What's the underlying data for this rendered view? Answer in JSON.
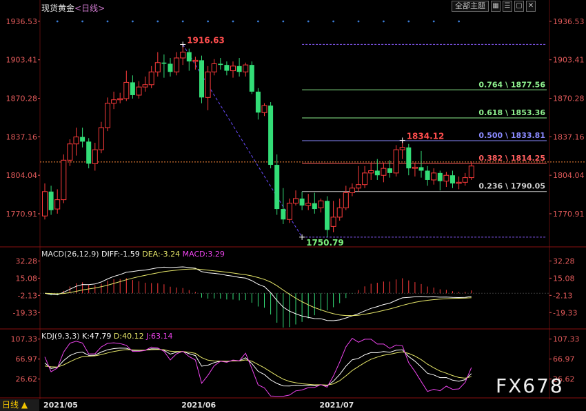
{
  "header": {
    "symbol": "现货黄金",
    "period": "<日线>",
    "main_indicator_button": "全部主题",
    "icons": [
      "grid-icon",
      "list-icon",
      "window-icon",
      "close-icon"
    ]
  },
  "footer": {
    "period_tab": "日线 ▲",
    "watermark": "FX678"
  },
  "chart_data": [
    {
      "type": "candlestick",
      "panel": "price",
      "y_ticks": [
        "1936.53",
        "1903.41",
        "1870.28",
        "1837.16",
        "1804.04",
        "1770.91"
      ],
      "y_tick_values": [
        1936.53,
        1903.41,
        1870.28,
        1837.16,
        1804.04,
        1770.91
      ],
      "ylim": [
        1743,
        1943
      ],
      "x_labels": [
        {
          "label": "2021/05",
          "index": 0
        },
        {
          "label": "2021/06",
          "index": 22
        },
        {
          "label": "2021/07",
          "index": 44
        }
      ],
      "annotations": [
        {
          "text": "1916.63",
          "index": 22,
          "value": 1916.63,
          "color": "#ff4d4d"
        },
        {
          "text": "1750.79",
          "index": 41,
          "value": 1750.79,
          "color": "#7cf07c"
        },
        {
          "text": "1834.12",
          "index": 57,
          "value": 1834.12,
          "color": "#ff4d4d"
        }
      ],
      "current_price_line": 1815.5,
      "fibonacci": {
        "from_index": 41,
        "levels": [
          {
            "label": "0.764 \\ 1877.56",
            "value": 1877.56,
            "color": "#8ef08e"
          },
          {
            "label": "0.618 \\ 1853.36",
            "value": 1853.36,
            "color": "#8ef08e"
          },
          {
            "label": "0.500 \\ 1833.81",
            "value": 1833.81,
            "color": "#8a8aff"
          },
          {
            "label": "0.382 \\ 1814.25",
            "value": 1814.25,
            "color": "#ff5e5e"
          },
          {
            "label": "0.236 \\ 1790.05",
            "value": 1790.05,
            "color": "#d0d0d0"
          }
        ],
        "top_value": 1916.63,
        "bottom_value": 1750.79
      },
      "candles": [
        {
          "o": 1769,
          "h": 1797,
          "c": 1790,
          "l": 1766
        },
        {
          "o": 1790,
          "h": 1795,
          "c": 1774,
          "l": 1770
        },
        {
          "o": 1775,
          "h": 1792,
          "c": 1783,
          "l": 1771
        },
        {
          "o": 1783,
          "h": 1822,
          "c": 1817,
          "l": 1780
        },
        {
          "o": 1817,
          "h": 1835,
          "c": 1831,
          "l": 1812
        },
        {
          "o": 1831,
          "h": 1845,
          "c": 1837,
          "l": 1821
        },
        {
          "o": 1837,
          "h": 1845,
          "c": 1833,
          "l": 1828
        },
        {
          "o": 1833,
          "h": 1836,
          "c": 1814,
          "l": 1810
        },
        {
          "o": 1814,
          "h": 1832,
          "c": 1826,
          "l": 1808
        },
        {
          "o": 1826,
          "h": 1850,
          "c": 1845,
          "l": 1823
        },
        {
          "o": 1845,
          "h": 1871,
          "c": 1866,
          "l": 1842
        },
        {
          "o": 1866,
          "h": 1876,
          "c": 1869,
          "l": 1861
        },
        {
          "o": 1869,
          "h": 1875,
          "c": 1870,
          "l": 1866
        },
        {
          "o": 1870,
          "h": 1894,
          "c": 1884,
          "l": 1868
        },
        {
          "o": 1884,
          "h": 1890,
          "c": 1873,
          "l": 1870
        },
        {
          "o": 1873,
          "h": 1885,
          "c": 1880,
          "l": 1870
        },
        {
          "o": 1880,
          "h": 1889,
          "c": 1882,
          "l": 1876
        },
        {
          "o": 1882,
          "h": 1898,
          "c": 1893,
          "l": 1879
        },
        {
          "o": 1893,
          "h": 1910,
          "c": 1901,
          "l": 1889
        },
        {
          "o": 1901,
          "h": 1908,
          "c": 1900,
          "l": 1888
        },
        {
          "o": 1900,
          "h": 1905,
          "c": 1893,
          "l": 1889
        },
        {
          "o": 1893,
          "h": 1910,
          "c": 1905,
          "l": 1890
        },
        {
          "o": 1905,
          "h": 1916.6,
          "c": 1910,
          "l": 1899
        },
        {
          "o": 1910,
          "h": 1913,
          "c": 1902,
          "l": 1894
        },
        {
          "o": 1902,
          "h": 1906,
          "c": 1903,
          "l": 1895
        },
        {
          "o": 1903,
          "h": 1907,
          "c": 1871,
          "l": 1866
        },
        {
          "o": 1871,
          "h": 1898,
          "c": 1893,
          "l": 1860
        },
        {
          "o": 1893,
          "h": 1904,
          "c": 1900,
          "l": 1890
        },
        {
          "o": 1900,
          "h": 1905,
          "c": 1899,
          "l": 1895
        },
        {
          "o": 1899,
          "h": 1902,
          "c": 1894,
          "l": 1890
        },
        {
          "o": 1894,
          "h": 1902,
          "c": 1898,
          "l": 1888
        },
        {
          "o": 1898,
          "h": 1905,
          "c": 1893,
          "l": 1889
        },
        {
          "o": 1893,
          "h": 1901,
          "c": 1899,
          "l": 1889
        },
        {
          "o": 1899,
          "h": 1902,
          "c": 1876,
          "l": 1874
        },
        {
          "o": 1876,
          "h": 1879,
          "c": 1858,
          "l": 1852
        },
        {
          "o": 1858,
          "h": 1866,
          "c": 1864,
          "l": 1855
        },
        {
          "o": 1864,
          "h": 1867,
          "c": 1813,
          "l": 1810
        },
        {
          "o": 1813,
          "h": 1822,
          "c": 1775,
          "l": 1770
        },
        {
          "o": 1775,
          "h": 1793,
          "c": 1766,
          "l": 1762
        },
        {
          "o": 1766,
          "h": 1784,
          "c": 1780,
          "l": 1763
        },
        {
          "o": 1780,
          "h": 1791,
          "c": 1784,
          "l": 1778
        },
        {
          "o": 1784,
          "h": 1790,
          "c": 1778,
          "l": 1774
        },
        {
          "o": 1778,
          "h": 1788,
          "c": 1780,
          "l": 1774
        },
        {
          "o": 1780,
          "h": 1789,
          "c": 1775,
          "l": 1771
        },
        {
          "o": 1776,
          "h": 1784,
          "c": 1782,
          "l": 1772
        },
        {
          "o": 1782,
          "h": 1786,
          "c": 1757,
          "l": 1750.8
        },
        {
          "o": 1760,
          "h": 1782,
          "c": 1768,
          "l": 1755
        },
        {
          "o": 1768,
          "h": 1784,
          "c": 1776,
          "l": 1765
        },
        {
          "o": 1776,
          "h": 1795,
          "c": 1789,
          "l": 1774
        },
        {
          "o": 1789,
          "h": 1797,
          "c": 1793,
          "l": 1786
        },
        {
          "o": 1793,
          "h": 1812,
          "c": 1796,
          "l": 1790
        },
        {
          "o": 1796,
          "h": 1812,
          "c": 1806,
          "l": 1793
        },
        {
          "o": 1806,
          "h": 1815,
          "c": 1808,
          "l": 1800
        },
        {
          "o": 1808,
          "h": 1818,
          "c": 1804,
          "l": 1800
        },
        {
          "o": 1804,
          "h": 1815,
          "c": 1810,
          "l": 1798
        },
        {
          "o": 1810,
          "h": 1817,
          "c": 1806,
          "l": 1802
        },
        {
          "o": 1806,
          "h": 1830,
          "c": 1826,
          "l": 1803
        },
        {
          "o": 1826,
          "h": 1834.1,
          "c": 1828,
          "l": 1818
        },
        {
          "o": 1828,
          "h": 1831,
          "c": 1810,
          "l": 1804
        },
        {
          "o": 1810,
          "h": 1815,
          "c": 1811,
          "l": 1803
        },
        {
          "o": 1811,
          "h": 1825,
          "c": 1808,
          "l": 1802
        },
        {
          "o": 1808,
          "h": 1812,
          "c": 1800,
          "l": 1795
        },
        {
          "o": 1800,
          "h": 1810,
          "c": 1806,
          "l": 1796
        },
        {
          "o": 1806,
          "h": 1808,
          "c": 1799,
          "l": 1791
        },
        {
          "o": 1799,
          "h": 1807,
          "c": 1804,
          "l": 1794
        },
        {
          "o": 1804,
          "h": 1808,
          "c": 1797,
          "l": 1793
        },
        {
          "o": 1797,
          "h": 1803,
          "c": 1798,
          "l": 1792
        },
        {
          "o": 1798,
          "h": 1806,
          "c": 1802,
          "l": 1795
        },
        {
          "o": 1802,
          "h": 1816,
          "c": 1812,
          "l": 1800
        }
      ]
    },
    {
      "type": "macd",
      "panel": "macd",
      "params": "MACD(26,12,9)",
      "diff_label": "DIFF:-1.59",
      "dea_label": "DEA:-3.24",
      "macd_label": "MACD:3.29",
      "y_ticks": [
        "32.28",
        "15.08",
        "-2.13",
        "-19.33"
      ],
      "y_tick_values": [
        32.28,
        15.08,
        -2.13,
        -19.33
      ],
      "ylim": [
        -35,
        45
      ]
    },
    {
      "type": "kdj",
      "panel": "kdj",
      "params": "KDJ(9,3,3)",
      "k_label": "K:47.79",
      "d_label": "D:40.12",
      "j_label": "J:63.14",
      "y_ticks": [
        "107.33",
        "66.97",
        "26.62"
      ],
      "y_tick_values": [
        107.33,
        66.97,
        26.62
      ],
      "ylim": [
        -10,
        125
      ]
    }
  ],
  "colors": {
    "up": "#ff3b3b",
    "down": "#33dd77",
    "axis_text": "#e25a5a",
    "grid": "#7a1010",
    "diff": "#ffffff",
    "dea": "#e8e86a",
    "macd_text": "#ee44ee",
    "k": "#ffffff",
    "d": "#e8e86a",
    "j": "#ee44ee",
    "dots": "#3a7bd5"
  }
}
